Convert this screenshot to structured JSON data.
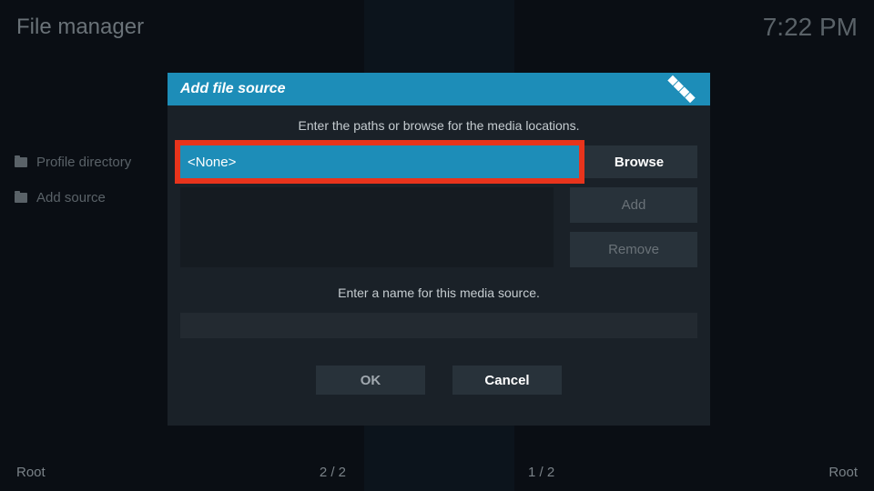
{
  "header": {
    "title": "File manager",
    "clock": "7:22 PM"
  },
  "sidebar": {
    "items": [
      {
        "label": "Profile directory"
      },
      {
        "label": "Add source"
      }
    ]
  },
  "footer": {
    "left": "Root",
    "center_left": "2 / 2",
    "center_right": "1 / 2",
    "right": "Root"
  },
  "dialog": {
    "title": "Add file source",
    "path_prompt": "Enter the paths or browse for the media locations.",
    "path_value": "<None>",
    "browse_label": "Browse",
    "add_label": "Add",
    "remove_label": "Remove",
    "name_prompt": "Enter a name for this media source.",
    "name_value": "",
    "ok_label": "OK",
    "cancel_label": "Cancel"
  }
}
